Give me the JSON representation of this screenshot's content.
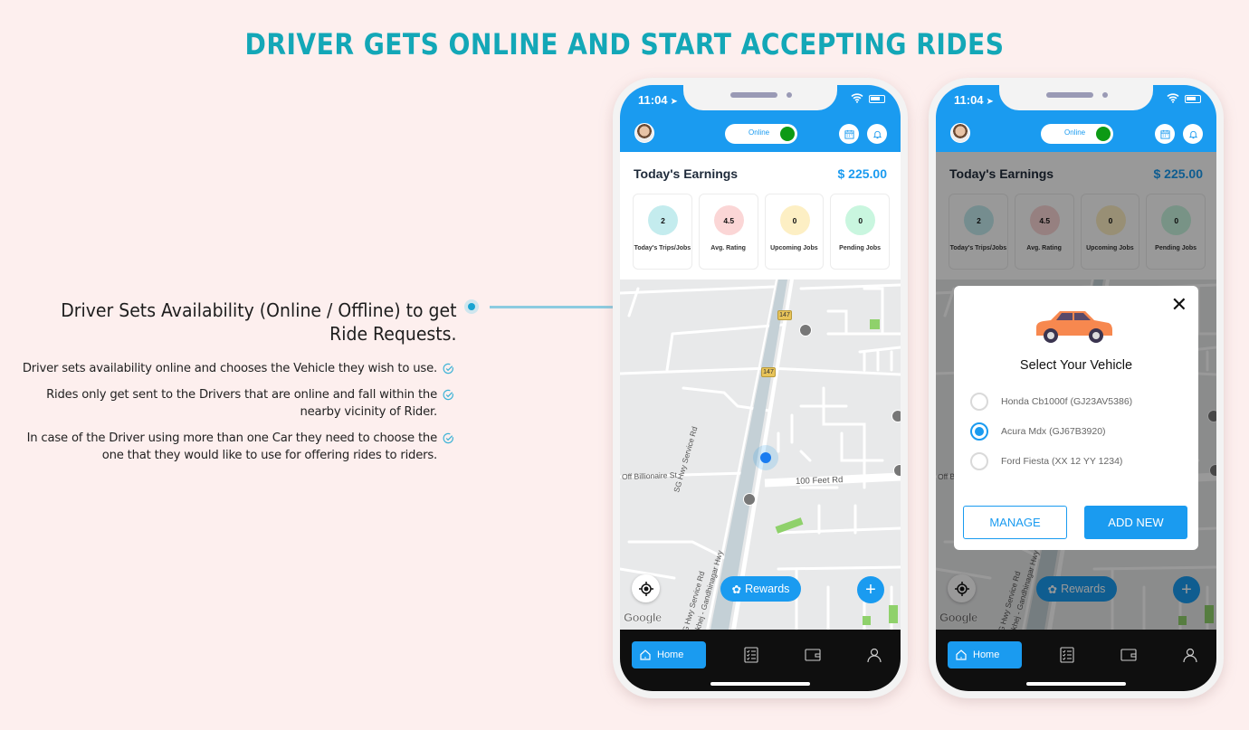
{
  "page": {
    "title": "DRIVER GETS ONLINE AND START ACCEPTING RIDES",
    "background": "#fdefee",
    "accent": "#13a7b7"
  },
  "feature": {
    "heading": "Driver Sets Availability (Online / Offline) to get Ride Requests.",
    "bullets": [
      "Driver sets availability online and chooses the Vehicle they wish to use.",
      "Rides only get sent to the Drivers that are online and fall within the nearby vicinity of Rider.",
      "In case of the Driver using more than one Car they need to choose the one that they would like to use for offering rides to riders."
    ],
    "bullet_icon": "check-circle-icon"
  },
  "app": {
    "primary_color": "#1a9bf0",
    "status_bar": {
      "time": "11:04"
    },
    "header": {
      "toggle_label": "Online",
      "toggle_state": "on",
      "calendar_icon": "calendar-icon",
      "bell_icon": "bell-icon"
    },
    "earnings": {
      "title": "Today's Earnings",
      "amount": "$ 225.00",
      "stats": [
        {
          "value": "2",
          "label": "Today's Trips/Jobs",
          "color": "#c4ecee"
        },
        {
          "value": "4.5",
          "label": "Avg. Rating",
          "color": "#fbd6d6"
        },
        {
          "value": "0",
          "label": "Upcoming Jobs",
          "color": "#fdefc4"
        },
        {
          "value": "0",
          "label": "Pending Jobs",
          "color": "#c9f6df"
        }
      ]
    },
    "map": {
      "labels": {
        "road_1": "Off Billionaire St",
        "road_2": "100 Feet Rd",
        "road_3": "SG Hwy Service Rd",
        "road_4": "SG Hwy Service Rd",
        "road_5": "Sarkhej - Gandhinagar Hwy",
        "shield_1": "147",
        "shield_2": "147"
      },
      "attribution": "Google",
      "rewards_label": "Rewards"
    },
    "nav": {
      "home_label": "Home",
      "items": [
        "tasks-icon",
        "wallet-icon",
        "profile-icon"
      ]
    }
  },
  "modal": {
    "title": "Select Your Vehicle",
    "options": [
      {
        "label": "Honda Cb1000f (GJ23AV5386)",
        "selected": false
      },
      {
        "label": "Acura Mdx (GJ67B3920)",
        "selected": true
      },
      {
        "label": "Ford Fiesta (XX 12 YY 1234)",
        "selected": false
      }
    ],
    "manage_label": "MANAGE",
    "add_new_label": "ADD NEW"
  }
}
